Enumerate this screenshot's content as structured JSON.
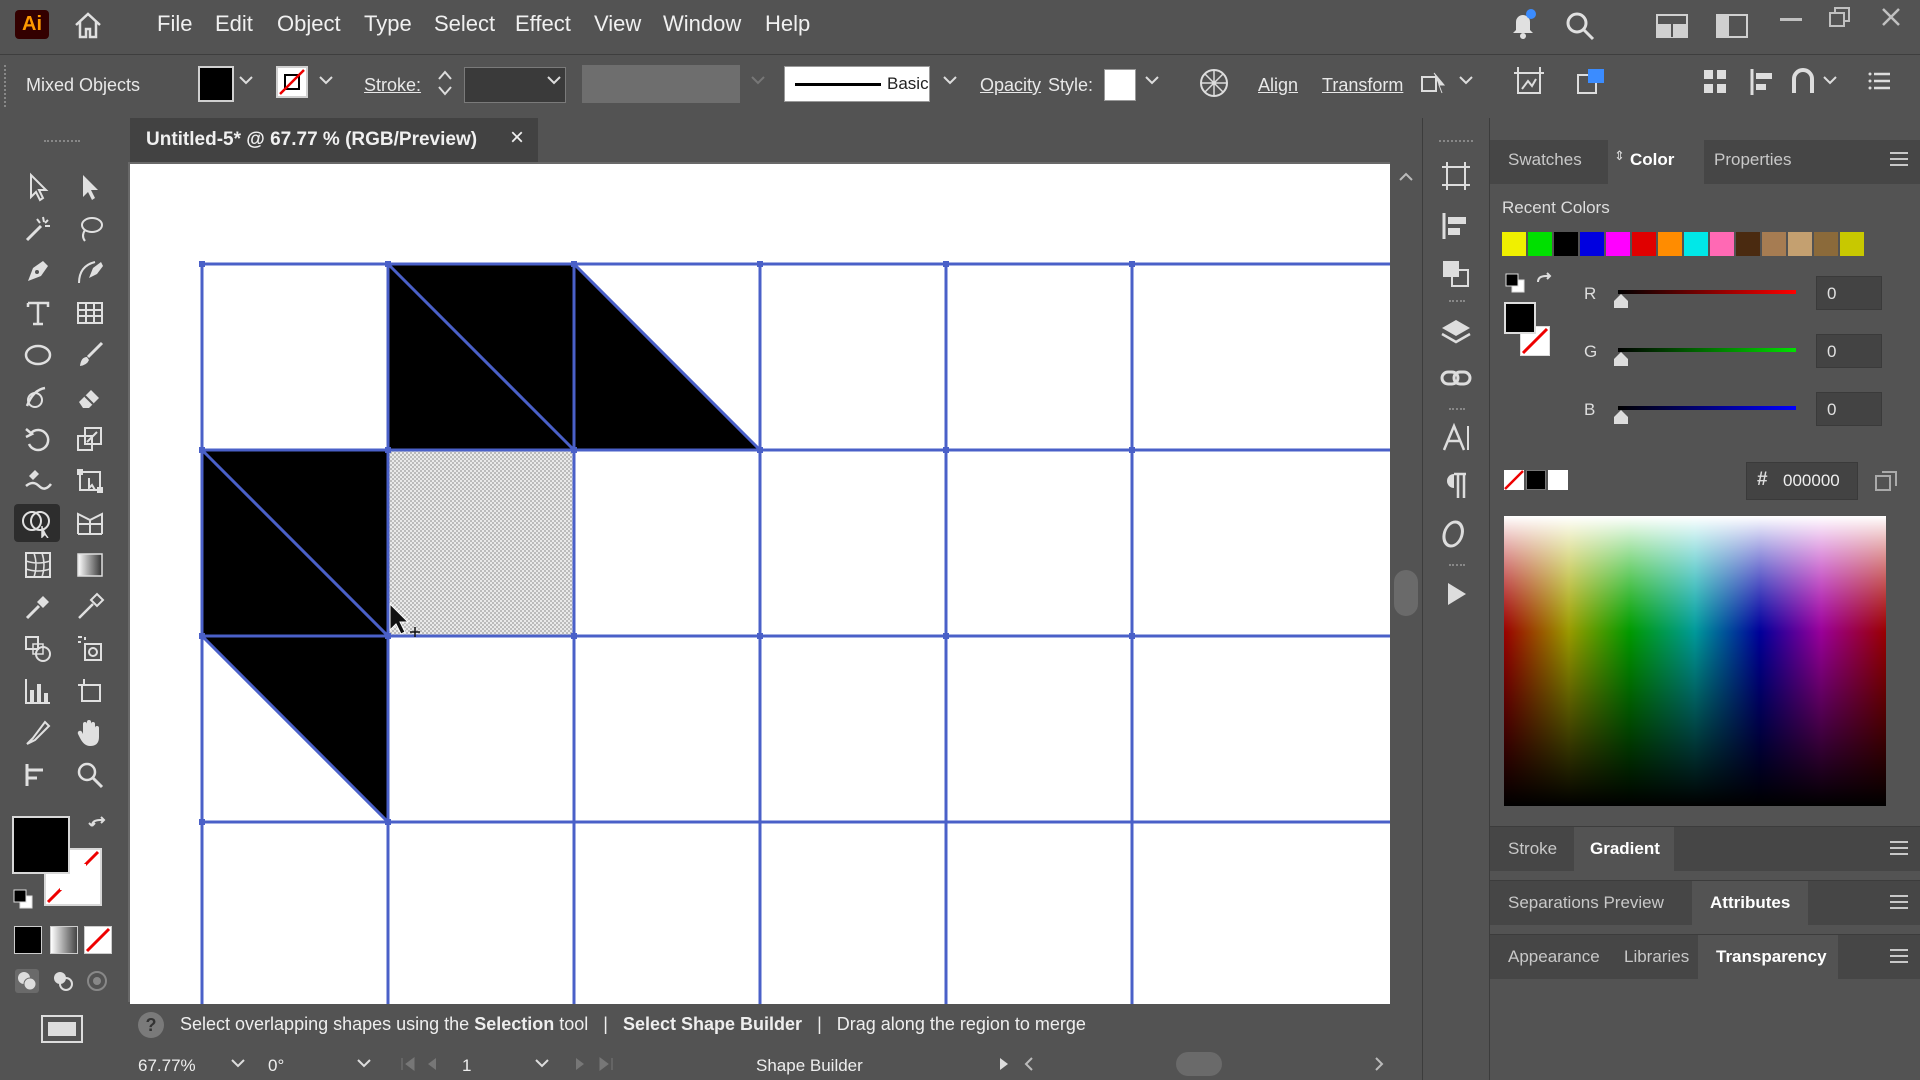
{
  "app": {
    "logo": "Ai"
  },
  "menus": [
    "File",
    "Edit",
    "Object",
    "Type",
    "Select",
    "Effect",
    "View",
    "Window",
    "Help"
  ],
  "control": {
    "selection_label": "Mixed Objects",
    "stroke_label": "Stroke:",
    "brush_label": "Basic",
    "opacity_label": "Opacity",
    "style_label": "Style:",
    "align_label": "Align",
    "transform_label": "Transform"
  },
  "document": {
    "tab_title": "Untitled-5* @ 67.77 % (RGB/Preview)",
    "close_glyph": "×"
  },
  "status": {
    "help_glyph": "?",
    "hint_part1": "Select overlapping shapes using the ",
    "hint_bold1": "Selection",
    "hint_part2": " tool",
    "sep": "|",
    "hint_bold2": "Select Shape Builder",
    "hint_part3": "Drag along the region to merge"
  },
  "bottom": {
    "zoom": "67.77%",
    "rotation": "0°",
    "artboard_num": "1",
    "tool_name": "Shape Builder"
  },
  "panel": {
    "tabs": [
      "Swatches",
      "Color",
      "Properties"
    ],
    "active_tab": "Color",
    "recent_colors_label": "Recent Colors",
    "recent_colors": [
      "#f0f000",
      "#00e000",
      "#000000",
      "#0000e0",
      "#ff00ff",
      "#e00000",
      "#ff8c00",
      "#00e8e8",
      "#ff69b4",
      "#4a2a10",
      "#a67c52",
      "#c4a070",
      "#8b6a3a",
      "#c8c800"
    ],
    "rgb": {
      "r_label": "R",
      "g_label": "G",
      "b_label": "B",
      "r": "0",
      "g": "0",
      "b": "0"
    },
    "hex_prefix": "#",
    "hex": "000000",
    "stroke_tab": "Stroke",
    "gradient_tab": "Gradient",
    "separations_tab": "Separations Preview",
    "attributes_tab": "Attributes",
    "appearance_tab": "Appearance",
    "libraries_tab": "Libraries",
    "transparency_tab": "Transparency"
  },
  "icons": {
    "home": "home-icon",
    "search": "search-icon",
    "bell": "bell-icon"
  },
  "colors": {
    "ui_bg": "#535353",
    "grid_line": "#4a60c8",
    "fill": "#000000",
    "accent_orange": "#ff9a00"
  }
}
